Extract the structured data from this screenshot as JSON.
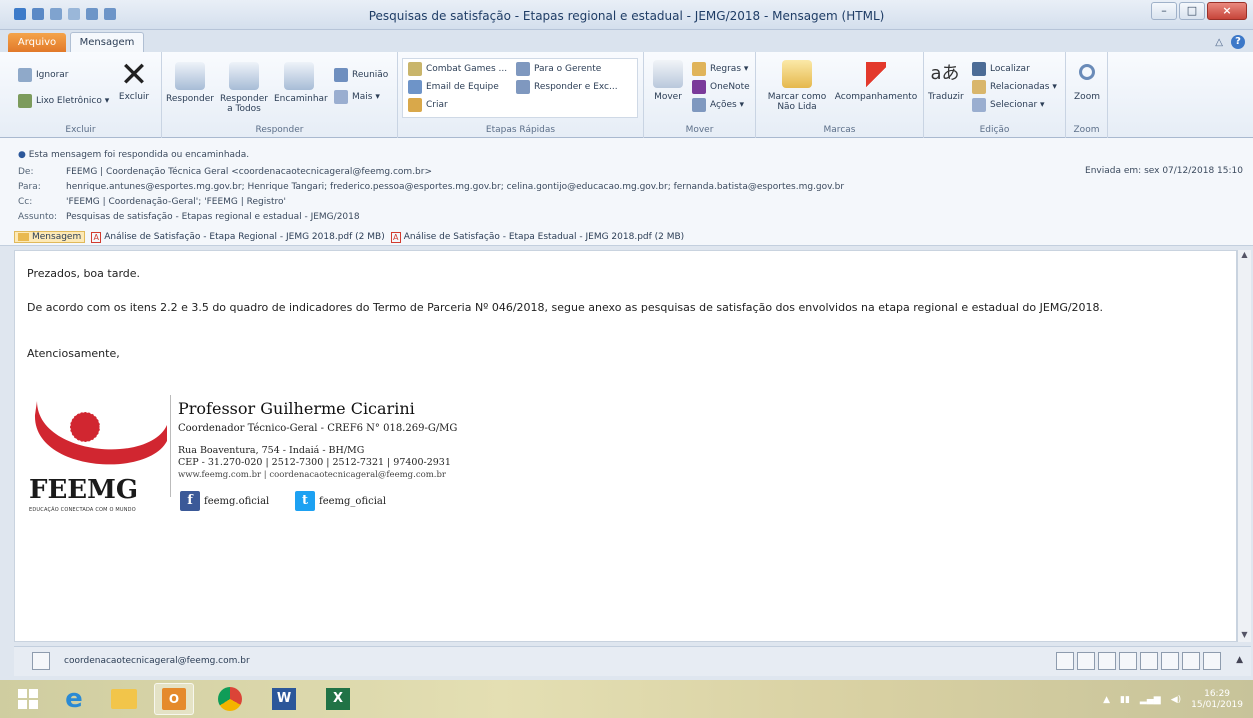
{
  "window": {
    "title": "Pesquisas de satisfação - Etapas regional e estadual - JEMG/2018 - Mensagem (HTML)",
    "minimize": "–",
    "maximize": "□",
    "close": "×"
  },
  "tabs": {
    "file": "Arquivo",
    "message": "Mensagem"
  },
  "ribbon": {
    "excluir": {
      "ignore": "Ignorar",
      "junk": "Lixo Eletrônico ▾",
      "delete": "Excluir",
      "label": "Excluir"
    },
    "responder": {
      "reply": "Responder",
      "reply_all": "Responder a Todos",
      "forward": "Encaminhar",
      "meeting": "Reunião",
      "more": "Mais ▾",
      "label": "Responder"
    },
    "quick_steps": {
      "combat": "Combat Games ...",
      "team_email": "Email de Equipe",
      "create": "Criar",
      "to_manager": "Para o Gerente",
      "reply_delete": "Responder e Exc...",
      "label": "Etapas Rápidas"
    },
    "mover": {
      "move": "Mover",
      "rules": "Regras ▾",
      "onenote": "OneNote",
      "actions": "Ações ▾",
      "label": "Mover"
    },
    "marcas": {
      "mark_unread": "Marcar como Não Lida",
      "followup": "Acompanhamento",
      "label": "Marcas"
    },
    "edicao": {
      "translate": "Traduzir",
      "find": "Localizar",
      "related": "Relacionadas ▾",
      "select": "Selecionar ▾",
      "label": "Edição"
    },
    "zoom": {
      "zoom": "Zoom",
      "label": "Zoom"
    }
  },
  "header": {
    "info": "Esta mensagem foi respondida ou encaminhada.",
    "from_label": "De:",
    "from": "FEEMG | Coordenação Técnica Geral <coordenacaotecnicageral@feemg.com.br>",
    "to_label": "Para:",
    "to": "henrique.antunes@esportes.mg.gov.br; Henrique Tangari; frederico.pessoa@esportes.mg.gov.br; celina.gontijo@educacao.mg.gov.br; fernanda.batista@esportes.mg.gov.br",
    "cc_label": "Cc:",
    "cc": "'FEEMG | Coordenação-Geral'; 'FEEMG | Registro'",
    "subject_label": "Assunto:",
    "subject": "Pesquisas de satisfação - Etapas regional e estadual - JEMG/2018",
    "sent_label": "Enviada em:",
    "sent": "sex 07/12/2018 15:10"
  },
  "attachments": [
    {
      "label": "Mensagem"
    },
    {
      "label": "Análise de Satisfação - Etapa Regional - JEMG 2018.pdf (2 MB)"
    },
    {
      "label": "Análise de Satisfação - Etapa Estadual - JEMG 2018.pdf (2 MB)"
    }
  ],
  "body": {
    "greeting": "Prezados, boa tarde.",
    "paragraph": "De acordo com os itens 2.2 e 3.5 do quadro de indicadores do Termo de Parceria Nº 046/2018, segue anexo as pesquisas de satisfação dos envolvidos na etapa regional e estadual do JEMG/2018.",
    "closing": "Atenciosamente,"
  },
  "signature": {
    "name": "Professor Guilherme Cicarini",
    "role": "Coordenador Técnico-Geral - CREF6 N° 018.269-G/MG",
    "address": "Rua Boaventura, 754 - Indaiá - BH/MG",
    "phones": "CEP - 31.270-020 | 2512-7300 | 2512-7321 | 97400-2931",
    "web": "www.feemg.com.br | coordenacaotecnicageral@feemg.com.br",
    "facebook": "feemg.oficial",
    "twitter": "feemg_oficial",
    "logo_text": "FEEMG",
    "logo_sub": "EDUCAÇÃO CONECTADA COM O MUNDO"
  },
  "people_pane": {
    "address": "coordenacaotecnicageral@feemg.com.br"
  },
  "taskbar": {
    "time": "16:29",
    "date": "15/01/2019"
  },
  "colors": {
    "accent": "#2b579a",
    "file_tab": "#e2792a",
    "logo_red": "#d12630"
  }
}
